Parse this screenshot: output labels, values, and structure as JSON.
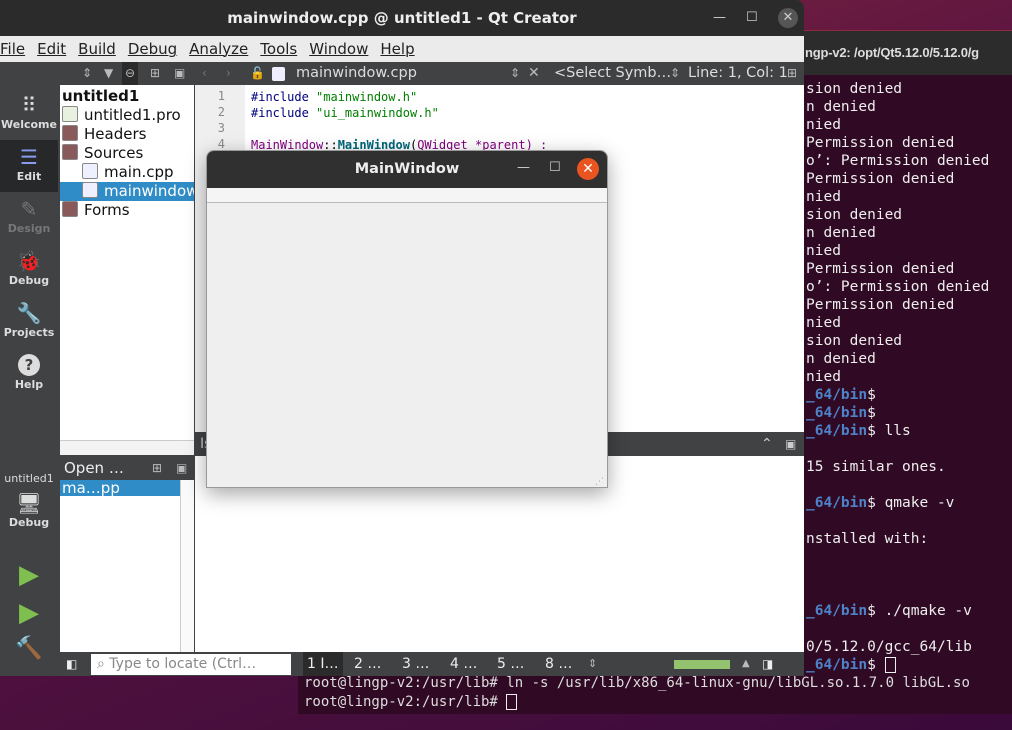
{
  "terminal": {
    "title": "ngp-v2: /opt/Qt5.12.0/5.12.0/g",
    "lines": [
      {
        "p": "",
        "t": "sion denied"
      },
      {
        "p": "",
        "t": "n denied"
      },
      {
        "p": "",
        "t": "nied"
      },
      {
        "p": "",
        "t": "Permission denied"
      },
      {
        "p": "",
        "t": "o’: Permission denied"
      },
      {
        "p": "",
        "t": "Permission denied"
      },
      {
        "p": "",
        "t": "nied"
      },
      {
        "p": "",
        "t": "sion denied"
      },
      {
        "p": "",
        "t": "n denied"
      },
      {
        "p": "",
        "t": "nied"
      },
      {
        "p": "",
        "t": "Permission denied"
      },
      {
        "p": "",
        "t": "o’: Permission denied"
      },
      {
        "p": "",
        "t": "Permission denied"
      },
      {
        "p": "",
        "t": "nied"
      },
      {
        "p": "",
        "t": "sion denied"
      },
      {
        "p": "",
        "t": "n denied"
      },
      {
        "p": "",
        "t": "nied"
      },
      {
        "p": "_64/bin",
        "t": "$"
      },
      {
        "p": "_64/bin",
        "t": "$"
      },
      {
        "p": "_64/bin",
        "t": "$ lls"
      },
      {
        "p": "",
        "t": ""
      },
      {
        "p": "",
        "t": "15 similar ones."
      },
      {
        "p": "",
        "t": ""
      },
      {
        "p": "_64/bin",
        "t": "$ qmake -v"
      },
      {
        "p": "",
        "t": ""
      },
      {
        "p": "",
        "t": "nstalled with:"
      },
      {
        "p": "",
        "t": ""
      },
      {
        "p": "",
        "t": ""
      },
      {
        "p": "",
        "t": ""
      },
      {
        "p": "_64/bin",
        "t": "$ ./qmake -v"
      },
      {
        "p": "",
        "t": ""
      },
      {
        "p": "",
        "t": "0/5.12.0/gcc_64/lib"
      },
      {
        "p": "_64/bin",
        "t": "$ ",
        "cursor": true
      }
    ],
    "bottom_lines": [
      "root@lingp-v2:/usr/lib# ln -s /usr/lib/x86_64-linux-gnu/libGL.so.1.7.0 libGL.so",
      "root@lingp-v2:/usr/lib# "
    ]
  },
  "qt": {
    "title": "mainwindow.cpp @ untitled1 - Qt Creator",
    "menu": [
      "File",
      "Edit",
      "Build",
      "Debug",
      "Analyze",
      "Tools",
      "Window",
      "Help"
    ],
    "toolbar": {
      "file": "mainwindow.cpp",
      "symbol": "<Select Symb…",
      "position": "Line: 1, Col: 1"
    },
    "modes": [
      {
        "label": "Welcome",
        "icon": "grid-icon",
        "active": false
      },
      {
        "label": "Edit",
        "icon": "document-icon",
        "active": true
      },
      {
        "label": "Design",
        "icon": "pencil-icon",
        "active": false,
        "disabled": true
      },
      {
        "label": "Debug",
        "icon": "bug-icon",
        "active": false
      },
      {
        "label": "Projects",
        "icon": "wrench-icon",
        "active": false
      },
      {
        "label": "Help",
        "icon": "help-icon",
        "active": false
      }
    ],
    "kit": {
      "project": "untitled1",
      "build": "Debug"
    },
    "tree": [
      {
        "label": "untitled1",
        "level": 0,
        "bold": true
      },
      {
        "label": "untitled1.pro",
        "level": 0,
        "icon": "pro-file-icon"
      },
      {
        "label": "Headers",
        "level": 0,
        "icon": "folder-icon"
      },
      {
        "label": "Sources",
        "level": 0,
        "icon": "folder-icon"
      },
      {
        "label": "main.cpp",
        "level": 1,
        "icon": "cpp-file-icon"
      },
      {
        "label": "mainwindow.cpp",
        "level": 1,
        "icon": "cpp-file-icon",
        "selected": true
      },
      {
        "label": "Forms",
        "level": 0,
        "icon": "folder-icon"
      }
    ],
    "open_docs": {
      "header": "Open …",
      "items": [
        "ma…pp"
      ]
    },
    "editor": {
      "line_numbers": [
        "1",
        "2",
        "3",
        "4"
      ],
      "lines": [
        [
          {
            "c": "#include ",
            "k": "pp"
          },
          {
            "c": "\"mainwindow.h\"",
            "k": "str"
          }
        ],
        [
          {
            "c": "#include ",
            "k": "pp"
          },
          {
            "c": "\"ui_mainwindow.h\"",
            "k": "str"
          }
        ],
        [],
        [
          {
            "c": "MainWindow",
            "k": "type"
          },
          {
            "c": "::",
            "k": "plain"
          },
          {
            "c": "MainWindow",
            "k": "fn"
          },
          {
            "c": "(",
            "k": "plain"
          },
          {
            "c": "QWidget",
            "k": "type"
          },
          {
            "c": " *parent) :",
            "k": "param"
          }
        ]
      ]
    },
    "output_pane": {
      "label": "Is"
    },
    "status": {
      "locate_placeholder": "Type to locate (Ctrl…",
      "tabs": [
        "1 I…",
        "2 …",
        "3 …",
        "4 …",
        "5 …",
        "8 …"
      ],
      "progress": 1.0,
      "progress_color": "#94c36f"
    }
  },
  "popup": {
    "title": "MainWindow",
    "close_color": "#e95420"
  }
}
